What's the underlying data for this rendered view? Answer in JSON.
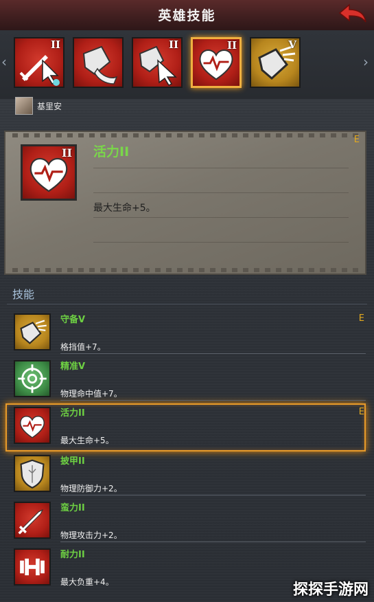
{
  "header": {
    "title": "英雄技能"
  },
  "top_skills": [
    {
      "icon": "sword-cursor-icon",
      "rank": "II",
      "color": "red"
    },
    {
      "icon": "shield-strike-icon",
      "rank": "",
      "color": "red"
    },
    {
      "icon": "shield-cursor-icon",
      "rank": "II",
      "color": "red"
    },
    {
      "icon": "heart-pulse-icon",
      "rank": "II",
      "color": "red",
      "selected": true
    },
    {
      "icon": "shield-break-icon",
      "rank": "V",
      "color": "gold"
    }
  ],
  "hero": {
    "name": "基里安"
  },
  "detail": {
    "title": "活力II",
    "rank": "II",
    "grade": "E",
    "description": "最大生命+5。"
  },
  "skills_section": {
    "title": "技能"
  },
  "skills": [
    {
      "name": "守备V",
      "desc": "格挡值+7。",
      "grade": "E",
      "icon": "shield-break-icon",
      "color": "gold"
    },
    {
      "name": "精准V",
      "desc": "物理命中值+7。",
      "grade": "",
      "icon": "crosshair-icon",
      "color": "green"
    },
    {
      "name": "活力II",
      "desc": "最大生命+5。",
      "grade": "E",
      "icon": "heart-pulse-icon",
      "color": "red"
    },
    {
      "name": "披甲II",
      "desc": "物理防御力+2。",
      "grade": "",
      "icon": "armor-shield-icon",
      "color": "gold"
    },
    {
      "name": "蛮力II",
      "desc": "物理攻击力+2。",
      "grade": "",
      "icon": "sword-icon",
      "color": "red"
    },
    {
      "name": "耐力II",
      "desc": "最大负重+4。",
      "grade": "",
      "icon": "dumbbell-icon",
      "color": "red"
    }
  ],
  "watermark": "探探手游网",
  "colors": {
    "accent": "#e79a2a",
    "skill_name": "#6ed143",
    "grade": "#e2a81f"
  }
}
